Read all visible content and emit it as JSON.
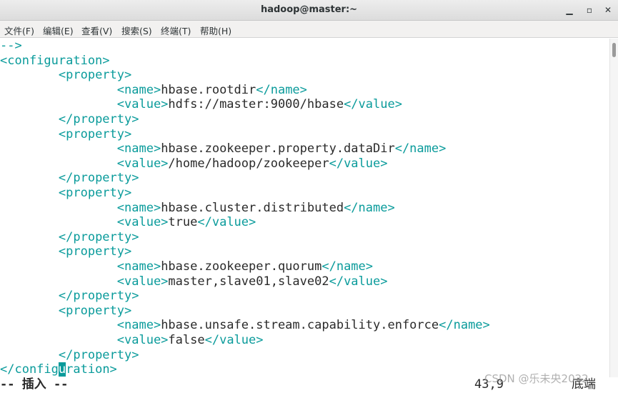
{
  "window": {
    "title": "hadoop@master:~",
    "minimize_glyph": "▁",
    "maximize_glyph": "▫",
    "close_glyph": "✕"
  },
  "menu": [
    "文件(F)",
    "编辑(E)",
    "查看(V)",
    "搜索(S)",
    "终端(T)",
    "帮助(H)"
  ],
  "editor": {
    "lines": [
      {
        "parts": [
          {
            "t": "-->",
            "c": "tag"
          }
        ]
      },
      {
        "parts": [
          {
            "t": "<configuration>",
            "c": "tag"
          }
        ]
      },
      {
        "parts": [
          {
            "t": "        ",
            "c": "txt"
          },
          {
            "t": "<property>",
            "c": "tag"
          }
        ]
      },
      {
        "parts": [
          {
            "t": "                ",
            "c": "txt"
          },
          {
            "t": "<name>",
            "c": "tag"
          },
          {
            "t": "hbase.rootdir",
            "c": "txt"
          },
          {
            "t": "</name>",
            "c": "tag"
          }
        ]
      },
      {
        "parts": [
          {
            "t": "                ",
            "c": "txt"
          },
          {
            "t": "<value>",
            "c": "tag"
          },
          {
            "t": "hdfs://master:9000/hbase",
            "c": "txt"
          },
          {
            "t": "</value>",
            "c": "tag"
          }
        ]
      },
      {
        "parts": [
          {
            "t": "        ",
            "c": "txt"
          },
          {
            "t": "</property>",
            "c": "tag"
          }
        ]
      },
      {
        "parts": [
          {
            "t": "        ",
            "c": "txt"
          },
          {
            "t": "<property>",
            "c": "tag"
          }
        ]
      },
      {
        "parts": [
          {
            "t": "                ",
            "c": "txt"
          },
          {
            "t": "<name>",
            "c": "tag"
          },
          {
            "t": "hbase.zookeeper.property.dataDir",
            "c": "txt"
          },
          {
            "t": "</name>",
            "c": "tag"
          }
        ]
      },
      {
        "parts": [
          {
            "t": "                ",
            "c": "txt"
          },
          {
            "t": "<value>",
            "c": "tag"
          },
          {
            "t": "/home/hadoop/zookeeper",
            "c": "txt"
          },
          {
            "t": "</value>",
            "c": "tag"
          }
        ]
      },
      {
        "parts": [
          {
            "t": "        ",
            "c": "txt"
          },
          {
            "t": "</property>",
            "c": "tag"
          }
        ]
      },
      {
        "parts": [
          {
            "t": "        ",
            "c": "txt"
          },
          {
            "t": "<property>",
            "c": "tag"
          }
        ]
      },
      {
        "parts": [
          {
            "t": "                ",
            "c": "txt"
          },
          {
            "t": "<name>",
            "c": "tag"
          },
          {
            "t": "hbase.cluster.distributed",
            "c": "txt"
          },
          {
            "t": "</name>",
            "c": "tag"
          }
        ]
      },
      {
        "parts": [
          {
            "t": "                ",
            "c": "txt"
          },
          {
            "t": "<value>",
            "c": "tag"
          },
          {
            "t": "true",
            "c": "txt"
          },
          {
            "t": "</value>",
            "c": "tag"
          }
        ]
      },
      {
        "parts": [
          {
            "t": "        ",
            "c": "txt"
          },
          {
            "t": "</property>",
            "c": "tag"
          }
        ]
      },
      {
        "parts": [
          {
            "t": "        ",
            "c": "txt"
          },
          {
            "t": "<property>",
            "c": "tag"
          }
        ]
      },
      {
        "parts": [
          {
            "t": "                ",
            "c": "txt"
          },
          {
            "t": "<name>",
            "c": "tag"
          },
          {
            "t": "hbase.zookeeper.quorum",
            "c": "txt"
          },
          {
            "t": "</name>",
            "c": "tag"
          }
        ]
      },
      {
        "parts": [
          {
            "t": "                ",
            "c": "txt"
          },
          {
            "t": "<value>",
            "c": "tag"
          },
          {
            "t": "master,slave01,slave02",
            "c": "txt"
          },
          {
            "t": "</value>",
            "c": "tag"
          }
        ]
      },
      {
        "parts": [
          {
            "t": "        ",
            "c": "txt"
          },
          {
            "t": "</property>",
            "c": "tag"
          }
        ]
      },
      {
        "parts": [
          {
            "t": "        ",
            "c": "txt"
          },
          {
            "t": "<property>",
            "c": "tag"
          }
        ]
      },
      {
        "parts": [
          {
            "t": "                ",
            "c": "txt"
          },
          {
            "t": "<name>",
            "c": "tag"
          },
          {
            "t": "hbase.unsafe.stream.capability.enforce",
            "c": "txt"
          },
          {
            "t": "</name>",
            "c": "tag"
          }
        ]
      },
      {
        "parts": [
          {
            "t": "                ",
            "c": "txt"
          },
          {
            "t": "<value>",
            "c": "tag"
          },
          {
            "t": "false",
            "c": "txt"
          },
          {
            "t": "</value>",
            "c": "tag"
          }
        ]
      },
      {
        "parts": [
          {
            "t": "        ",
            "c": "txt"
          },
          {
            "t": "</property>",
            "c": "tag"
          }
        ]
      },
      {
        "parts": [
          {
            "t": "</config",
            "c": "tag"
          },
          {
            "t": "u",
            "c": "cursor"
          },
          {
            "t": "ration>",
            "c": "tag"
          }
        ]
      }
    ]
  },
  "status": {
    "mode": "-- 插入 --",
    "position": "43,9",
    "scroll": "底端"
  },
  "watermark": "CSDN @乐未央2022",
  "colors": {
    "tag": "#0a9b9b",
    "text": "#2a2a2a",
    "cursor_bg": "#0a9b9b"
  }
}
